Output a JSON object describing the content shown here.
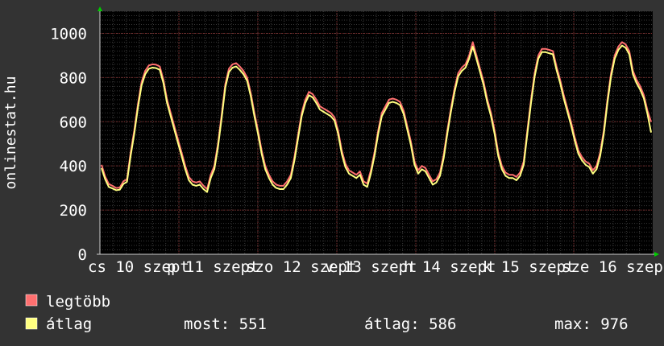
{
  "chart_data": {
    "type": "line",
    "ylabel": "onlinestat.hu",
    "ylim": [
      0,
      1100
    ],
    "yticks": [
      "0",
      "200",
      "400",
      "600",
      "800",
      "1000"
    ],
    "xtick_labels": [
      "cs 10 szept",
      "p 11 szept",
      "szo 12 szept",
      "v 13 szept",
      "h 14 szept",
      "k 15 szept",
      "sze 16 szept"
    ],
    "grid": true,
    "background": "#000000",
    "series": [
      {
        "name": "legtöbb",
        "color": "#ff7070",
        "values": [
          405,
          352,
          318,
          310,
          300,
          302,
          330,
          340,
          460,
          560,
          680,
          780,
          830,
          855,
          860,
          858,
          850,
          790,
          700,
          640,
          580,
          520,
          460,
          400,
          350,
          330,
          325,
          330,
          310,
          295,
          360,
          400,
          500,
          630,
          770,
          840,
          860,
          865,
          850,
          830,
          800,
          730,
          640,
          560,
          470,
          400,
          360,
          330,
          315,
          310,
          310,
          330,
          360,
          440,
          540,
          640,
          700,
          735,
          725,
          700,
          670,
          660,
          650,
          640,
          620,
          560,
          470,
          410,
          380,
          370,
          360,
          375,
          330,
          320,
          380,
          460,
          560,
          640,
          670,
          700,
          705,
          700,
          690,
          650,
          580,
          510,
          420,
          380,
          400,
          390,
          360,
          330,
          340,
          370,
          450,
          560,
          660,
          750,
          820,
          845,
          860,
          900,
          960,
          900,
          840,
          780,
          700,
          640,
          560,
          460,
          400,
          370,
          360,
          360,
          350,
          370,
          420,
          560,
          700,
          820,
          900,
          930,
          930,
          925,
          920,
          850,
          790,
          720,
          660,
          600,
          530,
          470,
          440,
          420,
          410,
          380,
          400,
          460,
          560,
          700,
          820,
          900,
          940,
          960,
          950,
          920,
          830,
          790,
          760,
          720,
          650,
          600
        ]
      },
      {
        "name": "átlag",
        "color": "#ffff80",
        "values": [
          390,
          340,
          305,
          298,
          290,
          292,
          318,
          328,
          445,
          545,
          665,
          765,
          815,
          840,
          845,
          843,
          835,
          775,
          685,
          625,
          565,
          505,
          445,
          385,
          335,
          315,
          310,
          315,
          295,
          282,
          345,
          385,
          485,
          615,
          755,
          825,
          845,
          850,
          835,
          815,
          785,
          715,
          625,
          545,
          455,
          385,
          345,
          315,
          300,
          295,
          295,
          315,
          345,
          425,
          525,
          625,
          685,
          720,
          710,
          685,
          655,
          645,
          635,
          625,
          605,
          545,
          455,
          395,
          365,
          355,
          345,
          360,
          315,
          305,
          365,
          445,
          545,
          625,
          655,
          685,
          690,
          685,
          675,
          635,
          565,
          495,
          405,
          365,
          385,
          375,
          345,
          315,
          325,
          355,
          435,
          545,
          645,
          735,
          805,
          830,
          845,
          885,
          940,
          885,
          825,
          765,
          685,
          625,
          545,
          445,
          385,
          355,
          345,
          345,
          335,
          355,
          405,
          545,
          685,
          805,
          885,
          915,
          915,
          910,
          905,
          835,
          775,
          705,
          645,
          585,
          515,
          455,
          425,
          405,
          395,
          365,
          385,
          445,
          545,
          685,
          805,
          885,
          925,
          945,
          935,
          905,
          815,
          775,
          745,
          705,
          635,
          551
        ]
      }
    ]
  },
  "legend": [
    {
      "name": "legtöbb",
      "color": "#ff7070"
    },
    {
      "name": "átlag",
      "color": "#ffff80"
    }
  ],
  "stats": {
    "most": "most: 551",
    "atlag": "átlag: 586",
    "max": "max: 976"
  }
}
